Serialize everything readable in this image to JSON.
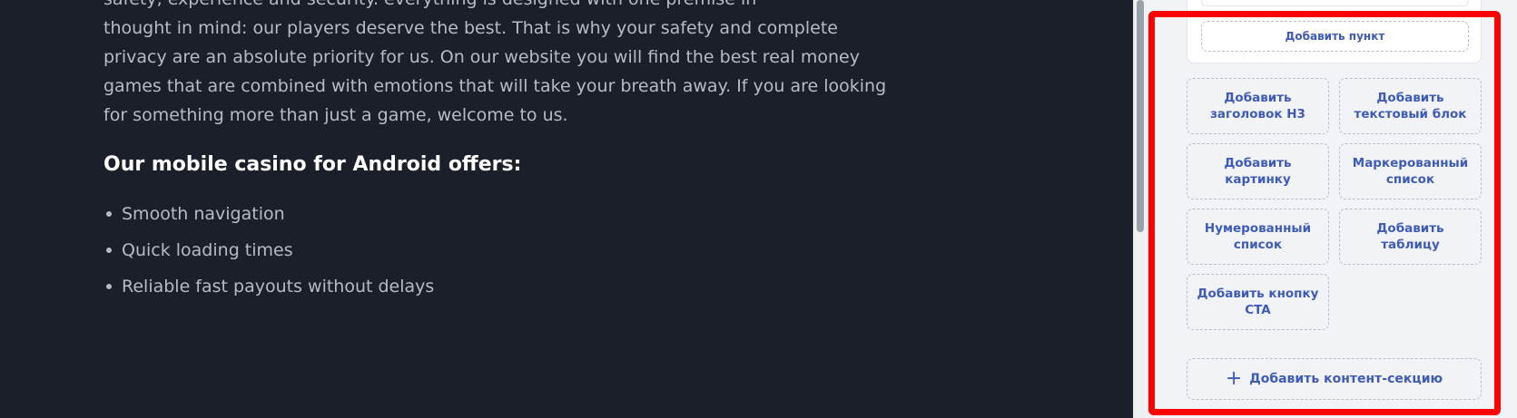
{
  "preview": {
    "intro_lines": [
      "safety, experience and security. everything is designed with one premise in",
      "thought in mind: our players deserve the best. That is why your safety and complete",
      "privacy are an absolute priority for us. On our website you will find the best real money",
      "games that are combined with emotions that will take your breath away. If you are looking",
      "for something more than just a game, welcome to us."
    ],
    "heading": "Our mobile casino for Android offers:",
    "bullets": [
      "Smooth navigation",
      "Quick loading times",
      "Reliable fast payouts without delays"
    ]
  },
  "panel": {
    "add_item_label": "Добавить пункт",
    "tiles": [
      "Добавить\nзаголовок H3",
      "Добавить\nтекстовый блок",
      "Добавить\nкартинку",
      "Маркерованный\nсписок",
      "Нумерованный\nсписок",
      "Добавить\nтаблицу",
      "Добавить кнопку\nCTA"
    ],
    "add_section_icon": "plus-icon",
    "add_section_label": "Добавить контент-секцию"
  },
  "colors": {
    "preview_bg": "#1b1f2a",
    "panel_bg": "#f1f3f6",
    "accent": "#3f5bb8",
    "highlight": "#ff0000"
  }
}
